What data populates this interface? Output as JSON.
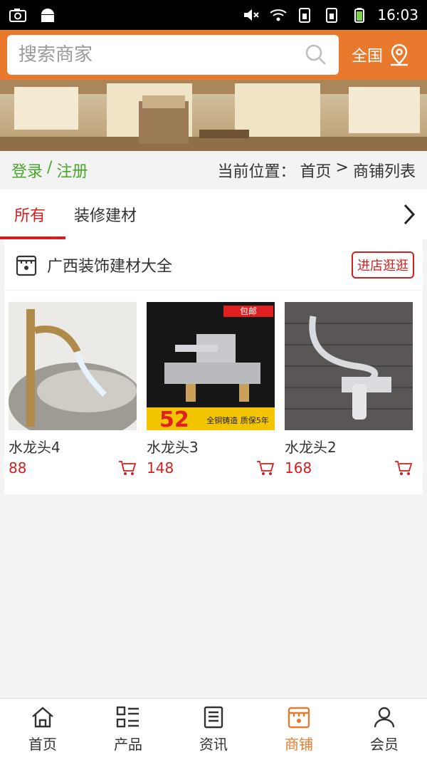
{
  "status_bar": {
    "time": "16:03"
  },
  "search": {
    "placeholder": "搜索商家",
    "region_label": "全国"
  },
  "breadcrumb": {
    "login": "登录",
    "separator": "/",
    "register": "注册",
    "prefix": "当前位置：",
    "home": "首页",
    "arrow": ">",
    "current": "商铺列表"
  },
  "tabs": [
    {
      "label": "所有",
      "active": true
    },
    {
      "label": "装修建材",
      "active": false
    }
  ],
  "shop": {
    "name": "广西装饰建材大全",
    "visit_label": "进店逛逛",
    "products": [
      {
        "name": "水龙头4",
        "price": "88"
      },
      {
        "name": "水龙头3",
        "price": "148"
      },
      {
        "name": "水龙头2",
        "price": "168"
      }
    ],
    "product3_badge": "包邮",
    "product3_promo_price": "52",
    "product3_promo_text": "全铜铸造 质保5年"
  },
  "bottom_nav": [
    {
      "label": "首页",
      "icon": "home-icon"
    },
    {
      "label": "产品",
      "icon": "grid-list-icon"
    },
    {
      "label": "资讯",
      "icon": "news-icon"
    },
    {
      "label": "商铺",
      "icon": "shop-icon",
      "active": true
    },
    {
      "label": "会员",
      "icon": "user-icon"
    }
  ],
  "colors": {
    "accent": "#e8792d",
    "price": "#d21f1f",
    "login": "#4aa52d"
  }
}
